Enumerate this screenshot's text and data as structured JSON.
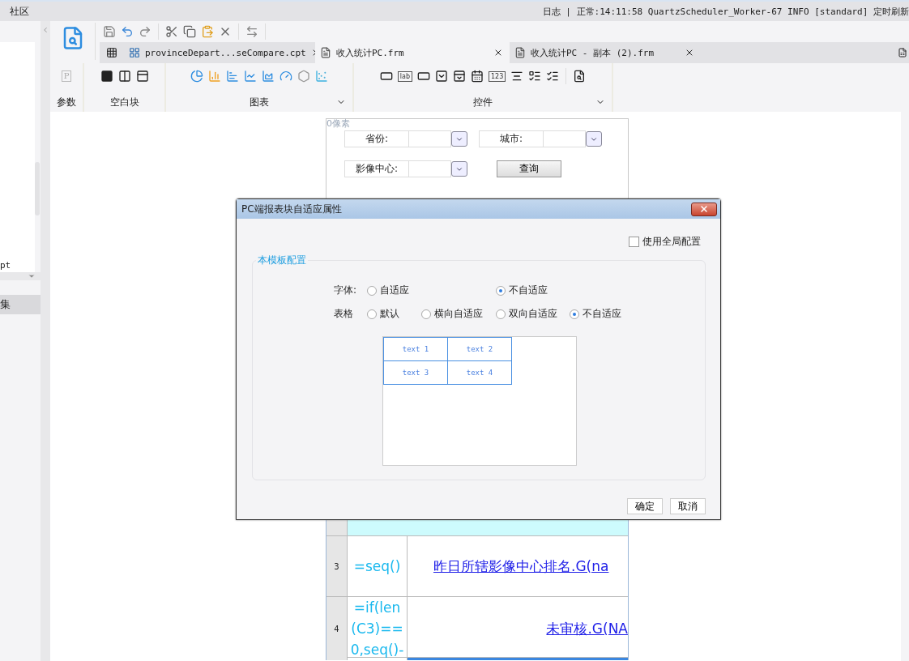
{
  "top_bar": {
    "community": "社区",
    "log": "日志 | 正常:14:11:58 QuartzScheduler_Worker-67 INFO [standard] 定时刷新"
  },
  "sidebar": {
    "items": [
      {
        "label": "pt",
        "selected": false
      },
      {
        "label": "集",
        "selected": true
      }
    ]
  },
  "tabs": [
    {
      "label": "provinceDepart...seCompare.cpt",
      "kind": "cpt",
      "selected": false
    },
    {
      "label": "收入统计PC.frm",
      "kind": "frm",
      "selected": true
    },
    {
      "label": "收入统计PC - 副本 (2).frm",
      "kind": "frm",
      "selected": false
    }
  ],
  "component_groups": [
    {
      "label": "参数",
      "kind": "param",
      "glyph": "P",
      "has_menu": false
    },
    {
      "label": "空白块",
      "kind": "blank",
      "has_menu": false
    },
    {
      "label": "图表",
      "kind": "chart",
      "has_menu": true
    },
    {
      "label": "控件",
      "kind": "widget",
      "glyphs": [
        "lab",
        "123"
      ],
      "has_menu": true
    }
  ],
  "form": {
    "margin_label": "0像素",
    "params": [
      {
        "label": "省份:"
      },
      {
        "label": "城市:"
      },
      {
        "label": "影像中心:"
      }
    ],
    "query_button": "查询"
  },
  "sheet": {
    "rows": [
      {
        "kind": "highlight"
      },
      {
        "number": "3",
        "kind": "normal",
        "formula": "=seq()",
        "link": "昨日所辖影像中心排名.G(na"
      },
      {
        "number": "4",
        "kind": "normal",
        "formula": "=if(len(C3)==0,seq()-",
        "link": "未审核.G(NA"
      }
    ]
  },
  "dialog": {
    "title": "PC端报表块自适应属性",
    "use_global": {
      "label": "使用全局配置",
      "checked": false
    },
    "section": "本模板配置",
    "font_row": {
      "label": "字体:",
      "options": [
        {
          "label": "自适应",
          "selected": false
        },
        {
          "label": "不自适应",
          "selected": true
        }
      ]
    },
    "table_row": {
      "label": "表格",
      "options": [
        {
          "label": "默认",
          "selected": false
        },
        {
          "label": "横向自适应",
          "selected": false
        },
        {
          "label": "双向自适应",
          "selected": false
        },
        {
          "label": "不自适应",
          "selected": true
        }
      ]
    },
    "preview_cells": [
      "text 1",
      "text 2",
      "text 3",
      "text 4"
    ],
    "buttons": [
      "确定",
      "取消"
    ]
  }
}
